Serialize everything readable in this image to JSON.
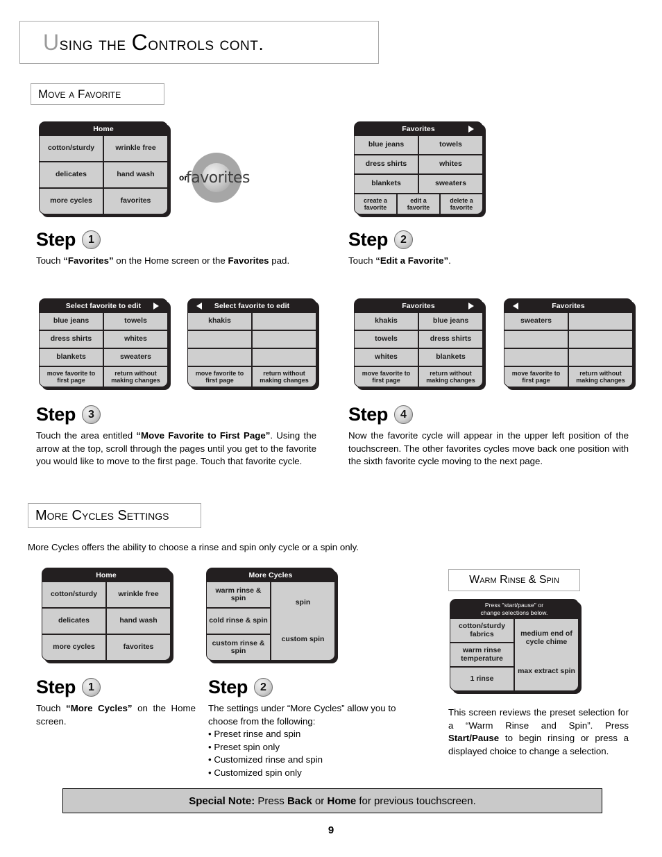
{
  "header": {
    "title_lead": "U",
    "title_rest": "sing the ",
    "title_c": "C",
    "title_tail": "ontrols cont.",
    "title_full": "Using the Controls cont."
  },
  "sections": {
    "move_favorite": "Move a Favorite",
    "more_cycles": "More Cycles Settings",
    "warm_rinse_spin": "Warm Rinse & Spin"
  },
  "intro": {
    "more_cycles_desc": "More Cycles offers the ability to choose a rinse and spin only cycle or a spin only."
  },
  "knob": {
    "or_label": "or",
    "label": "favorites"
  },
  "panels": {
    "home1": {
      "header": "Home",
      "cells": [
        "cotton/sturdy",
        "wrinkle free",
        "delicates",
        "hand wash",
        "more cycles",
        "favorites"
      ]
    },
    "favorites1": {
      "header": "Favorites",
      "arrow": "right",
      "cells": [
        "blue jeans",
        "towels",
        "dress shirts",
        "whites",
        "blankets",
        "sweaters"
      ],
      "actions": [
        "create a favorite",
        "edit a favorite",
        "delete a favorite"
      ]
    },
    "select_edit_p1": {
      "header": "Select favorite to edit",
      "arrow": "right",
      "cells": [
        "blue jeans",
        "towels",
        "dress shirts",
        "whites",
        "blankets",
        "sweaters"
      ],
      "actions": [
        "move favorite to first page",
        "return without making changes"
      ]
    },
    "select_edit_p2": {
      "header": "Select favorite to edit",
      "arrow": "left",
      "cells": [
        "khakis",
        "",
        "",
        "",
        "",
        ""
      ],
      "actions": [
        "move favorite to first page",
        "return without making changes"
      ]
    },
    "favorites_after_p1": {
      "header": "Favorites",
      "arrow": "right",
      "cells": [
        "khakis",
        "blue jeans",
        "towels",
        "dress shirts",
        "whites",
        "blankets"
      ],
      "actions": [
        "move favorite to first page",
        "return without making changes"
      ]
    },
    "favorites_after_p2": {
      "header": "Favorites",
      "arrow": "left",
      "cells": [
        "sweaters",
        "",
        "",
        "",
        "",
        ""
      ],
      "actions": [
        "move favorite to first page",
        "return without making changes"
      ]
    },
    "home2": {
      "header": "Home",
      "cells": [
        "cotton/sturdy",
        "wrinkle free",
        "delicates",
        "hand wash",
        "more cycles",
        "favorites"
      ]
    },
    "more_cycles_screen": {
      "header": "More Cycles",
      "left_cells": [
        "warm rinse & spin",
        "cold rinse & spin",
        "custom rinse & spin"
      ],
      "right_cells": [
        "spin",
        "custom spin"
      ]
    },
    "warm_rinse_screen": {
      "header_line1": "Press \"start/pause\" or",
      "header_line2": "change selections below.",
      "left_cells": [
        "cotton/sturdy fabrics",
        "warm rinse temperature",
        "1 rinse"
      ],
      "right_cells": [
        "medium end of cycle chime",
        "max extract spin"
      ]
    }
  },
  "steps": {
    "s1": {
      "word": "Step",
      "number": "1",
      "text_parts": [
        "Touch ",
        "“Favorites”",
        " on the Home screen or the ",
        "Favorites",
        " pad."
      ]
    },
    "s2": {
      "word": "Step",
      "number": "2",
      "text_parts": [
        "Touch ",
        "“Edit a Favorite”",
        "."
      ]
    },
    "s3": {
      "word": "Step",
      "number": "3",
      "text_parts": [
        "Touch the area entitled ",
        "“Move Favorite to First Page”",
        ". Using the arrow at the top, scroll through the pages until you get to the favorite you would like to move to the first page. Touch that favorite cycle."
      ]
    },
    "s4": {
      "word": "Step",
      "number": "4",
      "text": "Now the favorite cycle will appear in the upper left position of the touchscreen. The other favorites cycles move back one position with the sixth favorite cycle moving to the next page."
    },
    "s5": {
      "word": "Step",
      "number": "1",
      "text_parts": [
        "Touch ",
        "“More Cycles”",
        " on the Home screen."
      ]
    },
    "s6": {
      "word": "Step",
      "number": "2",
      "intro": "The settings under “More Cycles” allow you to choose from the following:",
      "bullets": [
        "Preset rinse and spin",
        "Preset spin only",
        "Customized rinse and spin",
        "Customized spin only"
      ]
    }
  },
  "warm_note": {
    "part1": "This screen reviews the preset selection for a “Warm Rinse and Spin”. Press ",
    "bold": "Start/Pause",
    "part2": " to begin rinsing or press a displayed choice to change a selection."
  },
  "special_note": {
    "label": "Special Note:",
    "mid1": " Press ",
    "b1": "Back",
    "mid2": " or ",
    "b2": "Home",
    "tail": " for previous touchscreen."
  },
  "page_number": "9",
  "colors": {
    "screen_bg": "#231f20",
    "cell_bg": "#cfcfcf",
    "note_bg": "#c9c9c9"
  }
}
